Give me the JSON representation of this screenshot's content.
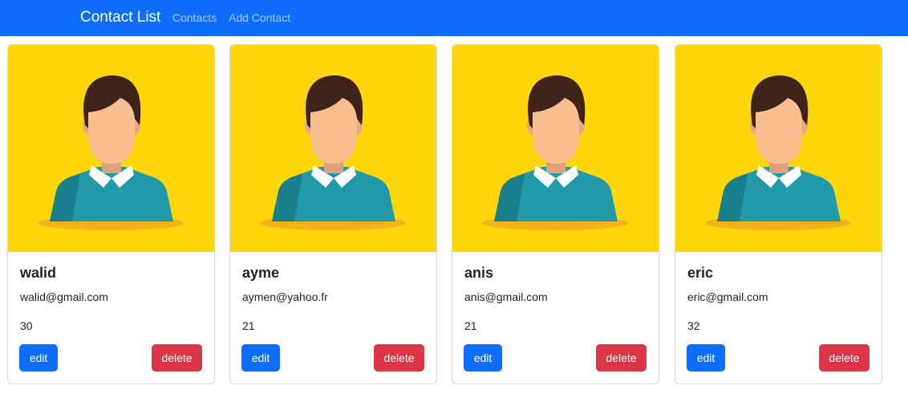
{
  "navbar": {
    "brand": "Contact List",
    "links": [
      "Contacts",
      "Add Contact"
    ]
  },
  "contacts": [
    {
      "name": "walid",
      "email": "walid@gmail.com",
      "age": "30",
      "edit_label": "edit",
      "delete_label": "delete"
    },
    {
      "name": "ayme",
      "email": "aymen@yahoo.fr",
      "age": "21",
      "edit_label": "edit",
      "delete_label": "delete"
    },
    {
      "name": "anis",
      "email": "anis@gmail.com",
      "age": "21",
      "edit_label": "edit",
      "delete_label": "delete"
    },
    {
      "name": "eric",
      "email": "eric@gmail.com",
      "age": "32",
      "edit_label": "edit",
      "delete_label": "delete"
    }
  ],
  "colors": {
    "navbar": "#0d6efd",
    "edit_button": "#0d6efd",
    "delete_button": "#dc3545",
    "avatar_background": "#ffd60a"
  },
  "icons": {
    "avatar": "avatar-icon"
  }
}
